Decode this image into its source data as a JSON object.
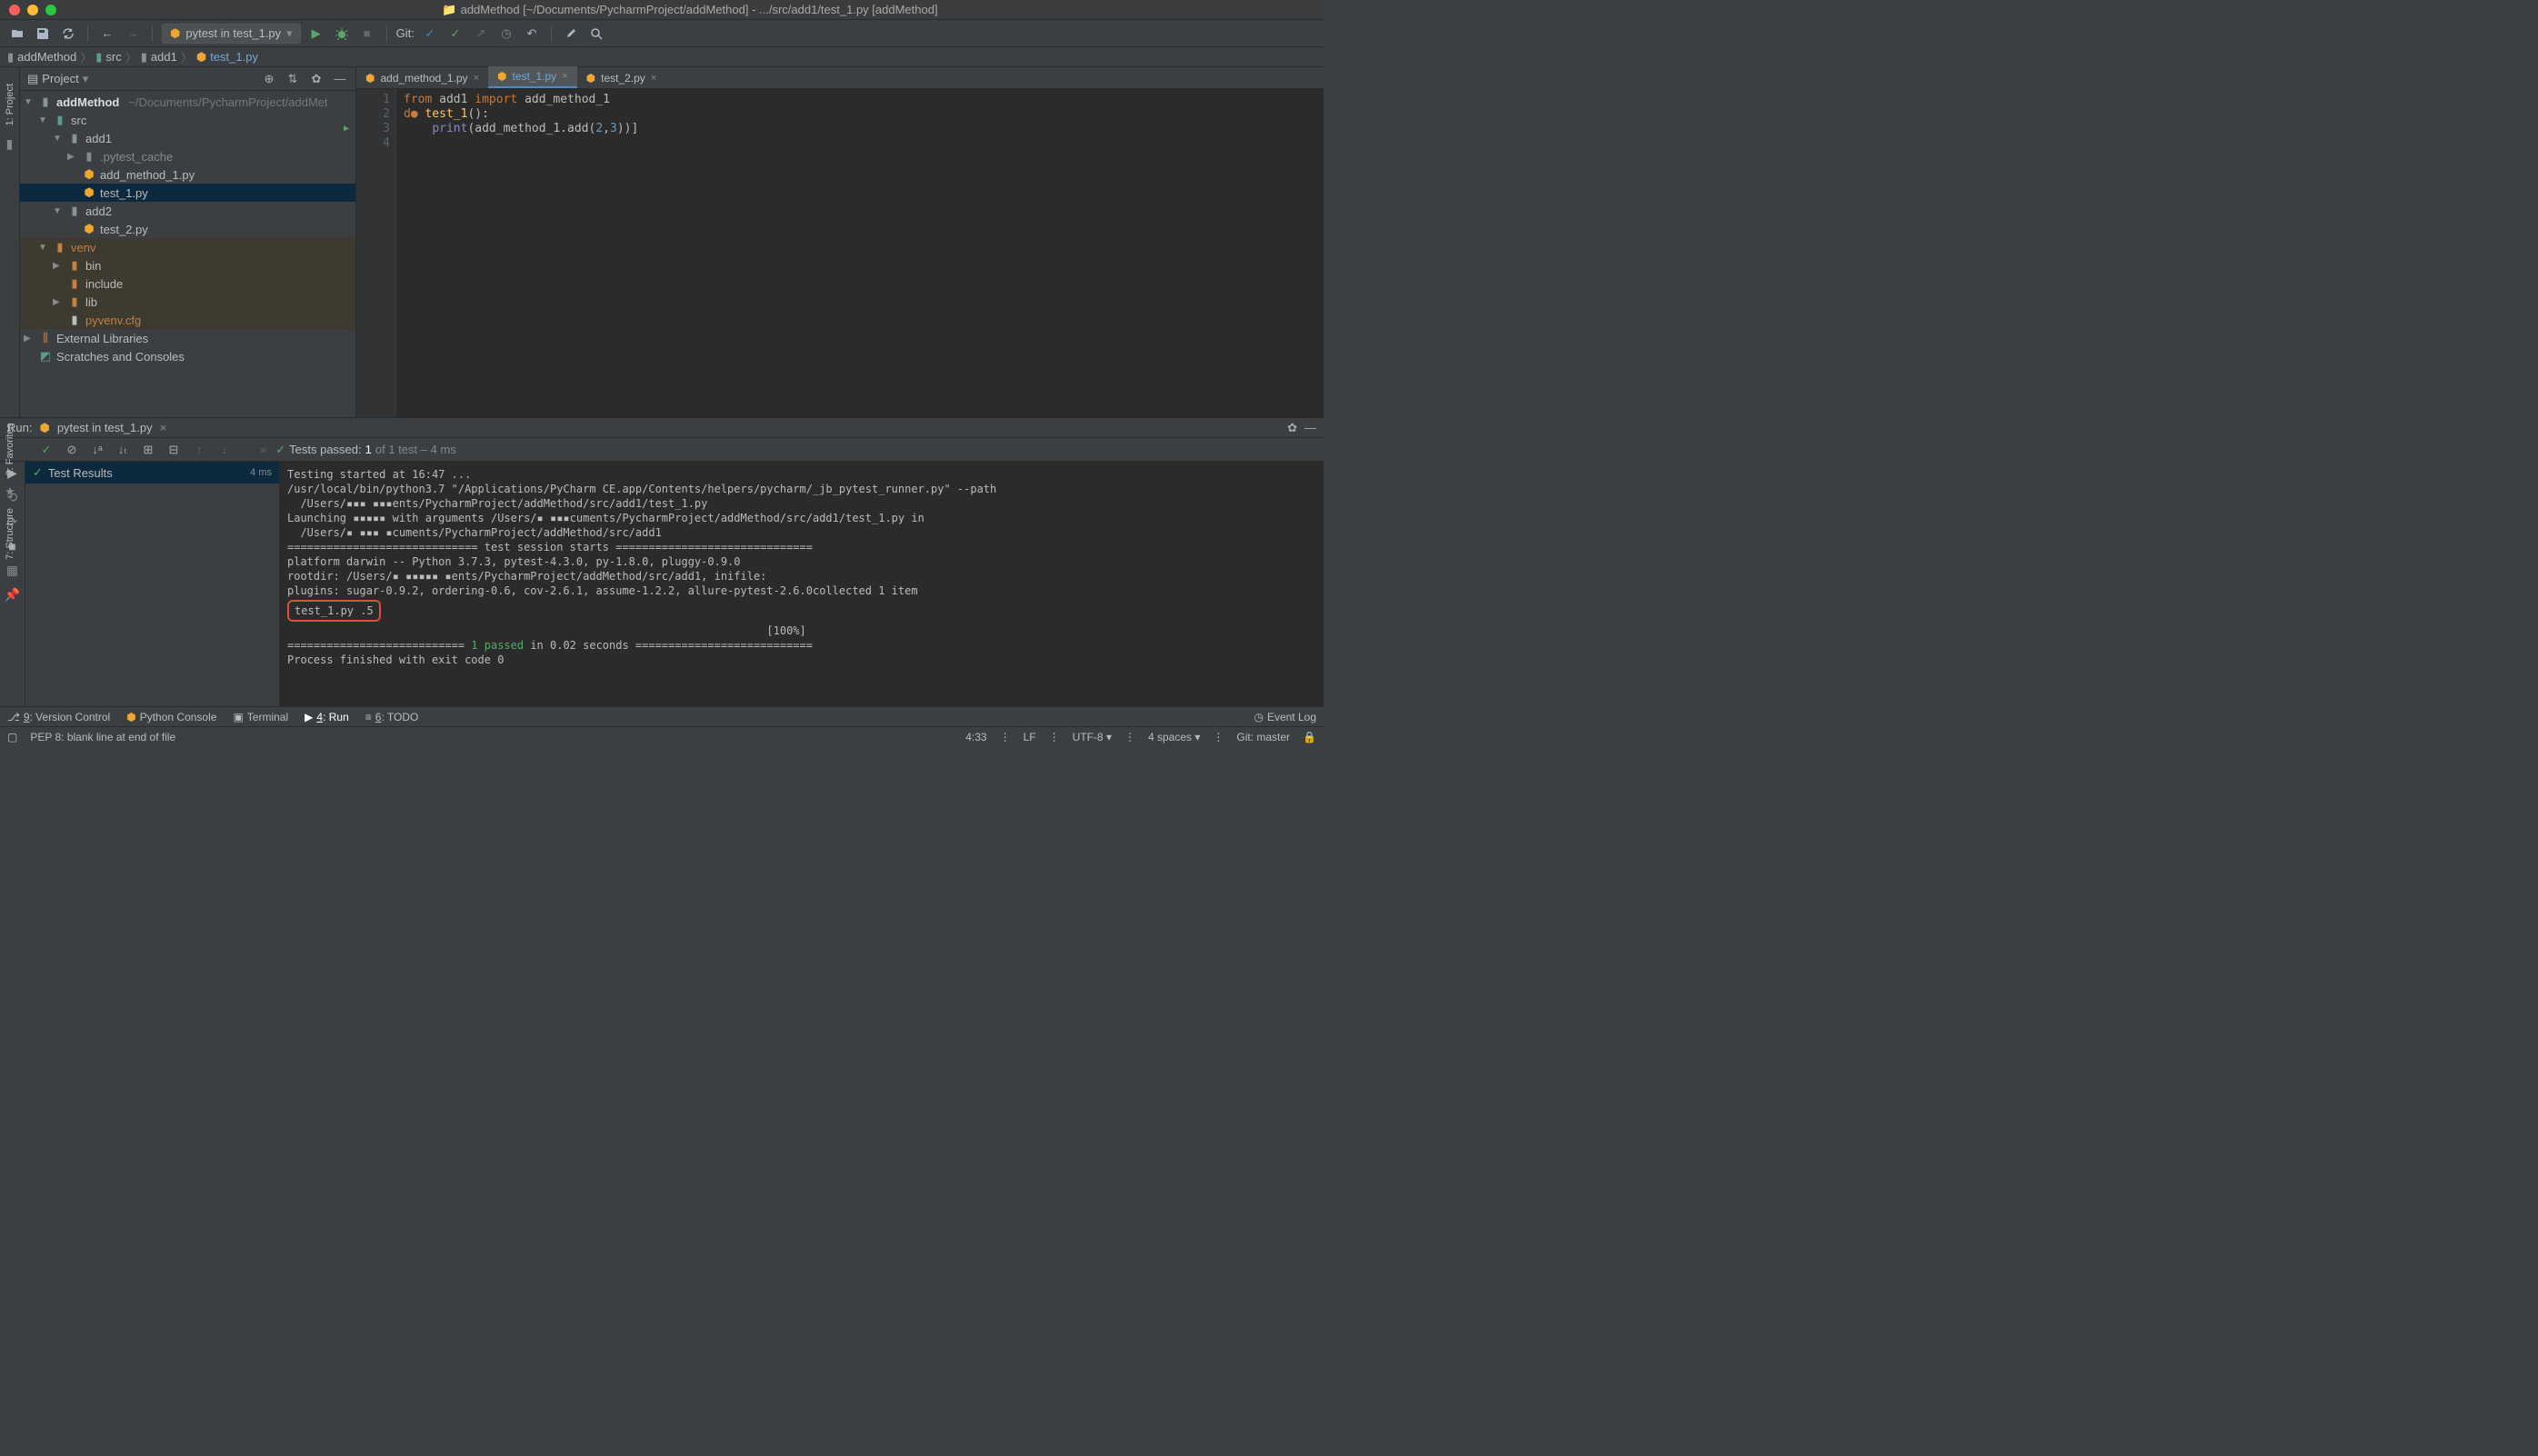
{
  "title": "addMethod [~/Documents/PycharmProject/addMethod] - .../src/add1/test_1.py [addMethod]",
  "toolbar": {
    "run_config_label": "pytest in test_1.py",
    "git_label": "Git:"
  },
  "breadcrumbs": [
    "addMethod",
    "src",
    "add1",
    "test_1.py"
  ],
  "project_header": {
    "title": "Project"
  },
  "tree": {
    "root": "addMethod",
    "root_path": "~/Documents/PycharmProject/addMet",
    "src": "src",
    "add1": "add1",
    "pytest_cache": ".pytest_cache",
    "add_method_1": "add_method_1.py",
    "test_1": "test_1.py",
    "add2": "add2",
    "test_2": "test_2.py",
    "venv": "venv",
    "bin": "bin",
    "include": "include",
    "lib": "lib",
    "pyvenv": "pyvenv.cfg",
    "ext_lib": "External Libraries",
    "scratches": "Scratches and Consoles"
  },
  "tabs": [
    {
      "label": "add_method_1.py",
      "active": false
    },
    {
      "label": "test_1.py",
      "active": true
    },
    {
      "label": "test_2.py",
      "active": false
    }
  ],
  "code": {
    "lines": [
      "1",
      "2",
      "3",
      "4"
    ],
    "l1_from": "from",
    "l1_mod": " add1 ",
    "l1_import": "import",
    "l1_name": " add_method_1",
    "l2_def": "d",
    "l2_circle": "●",
    "l2_fn": " test_1",
    "l2_paren": "():",
    "l3_indent": "    ",
    "l3_print": "print",
    "l3_open": "(",
    "l3_call": "add_method_1.add(",
    "l3_num1": "2",
    "l3_comma": ",",
    "l3_num2": "3",
    "l3_close": "))]"
  },
  "run": {
    "label": "Run:",
    "config": "pytest in test_1.py",
    "tests_passed_prefix": "Tests passed: ",
    "tests_passed_count": "1",
    "tests_passed_suffix": " of 1 test – 4 ms",
    "tree_root": "Test Results",
    "tree_time": "4 ms"
  },
  "console": {
    "l1": "Testing started at 16:47 ...",
    "l2": "/usr/local/bin/python3.7 \"/Applications/PyCharm CE.app/Contents/helpers/pycharm/_jb_pytest_runner.py\" --path",
    "l3": "  /Users/▪▪▪ ▪▪▪ents/PycharmProject/addMethod/src/add1/test_1.py",
    "l4": "Launching ▪▪▪▪▪ with arguments /Users/▪ ▪▪▪cuments/PycharmProject/addMethod/src/add1/test_1.py in",
    "l5": "  /Users/▪ ▪▪▪ ▪cuments/PycharmProject/addMethod/src/add1",
    "l6": "",
    "l7": "============================= test session starts ==============================",
    "l8": "platform darwin -- Python 3.7.3, pytest-4.3.0, py-1.8.0, pluggy-0.9.0",
    "l9": "rootdir: /Users/▪ ▪▪▪▪▪ ▪ents/PycharmProject/addMethod/src/add1, inifile:",
    "l10": "plugins: sugar-0.9.2, ordering-0.6, cov-2.6.1, assume-1.2.2, allure-pytest-2.6.0collected 1 item",
    "l11": "",
    "l12": "test_1.py .5",
    "l13": "                                                                         [100%]",
    "l14a": "=========================== ",
    "l14b": "1 passed",
    "l14c": " in 0.02 seconds ===========================",
    "l15": "Process finished with exit code 0"
  },
  "bottom_tabs": {
    "version_control": "9: Version Control",
    "python_console": "Python Console",
    "terminal": "Terminal",
    "run": "4: Run",
    "todo": "6: TODO",
    "event_log": "Event Log"
  },
  "status": {
    "pep8": "PEP 8: blank line at end of file",
    "cursor": "4:33",
    "lf": "LF",
    "enc": "UTF-8",
    "indent": "4 spaces",
    "git": "Git: master"
  },
  "side_tabs": {
    "project": "1: Project",
    "favorites": "2: Favorites",
    "structure": "7: Structure"
  }
}
